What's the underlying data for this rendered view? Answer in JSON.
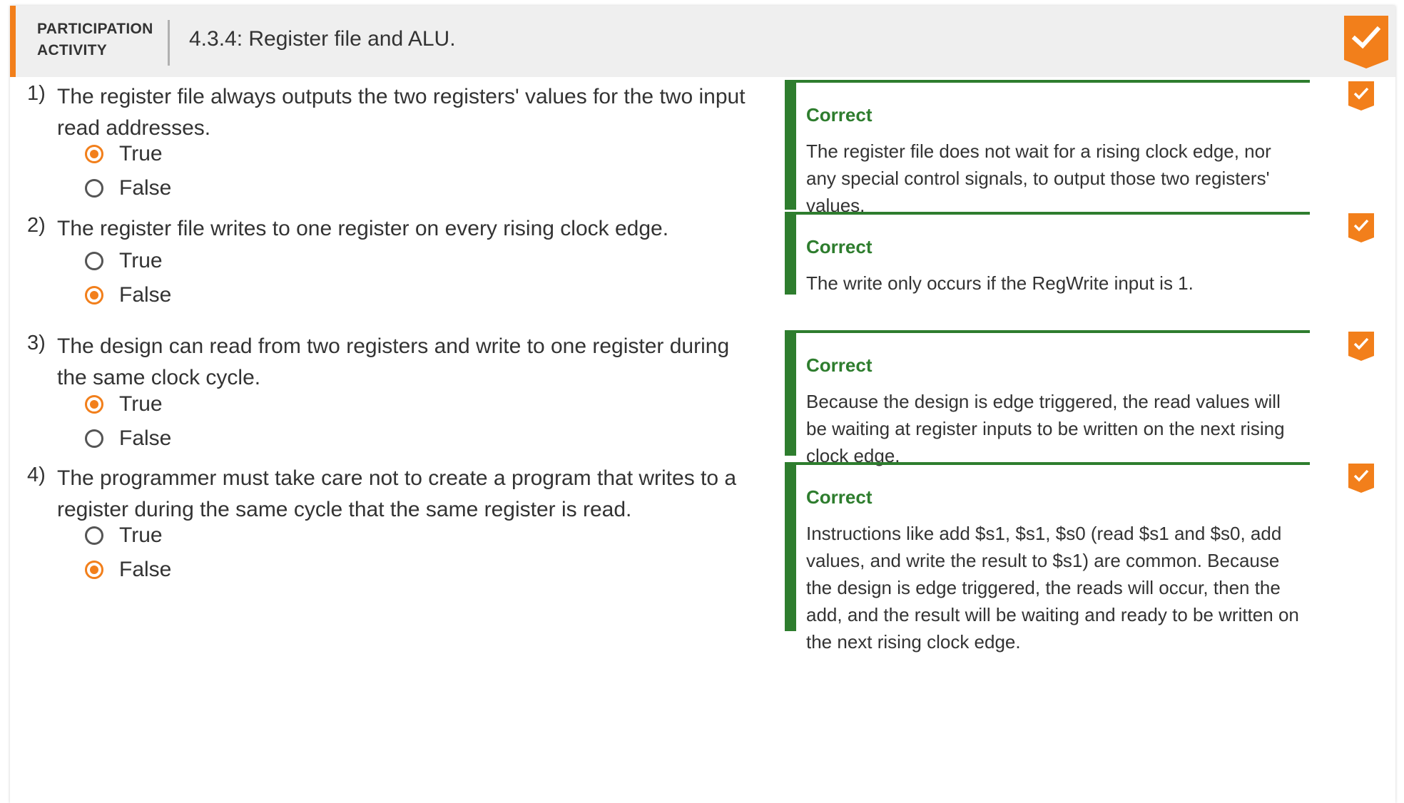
{
  "header": {
    "participation_label_line1": "PARTICIPATION",
    "participation_label_line2": "ACTIVITY",
    "activity_title": "4.3.4: Register file and ALU."
  },
  "colors": {
    "accent": "#f27f1b",
    "correct": "#2e7d2e"
  },
  "icons": {
    "completion": "checkmark-icon",
    "radio_selected": "radio-selected-icon",
    "radio_unselected": "radio-unselected-icon"
  },
  "questions": [
    {
      "number": "1)",
      "text": "The register file always outputs the two registers' values for the two input read addresses.",
      "options": [
        {
          "label": "True",
          "selected": true
        },
        {
          "label": "False",
          "selected": false
        }
      ],
      "feedback_title": "Correct",
      "feedback_text": "The register file does not wait for a rising clock edge, nor any special control signals, to output those two registers' values."
    },
    {
      "number": "2)",
      "text": "The register file writes to one register on every rising clock edge.",
      "options": [
        {
          "label": "True",
          "selected": false
        },
        {
          "label": "False",
          "selected": true
        }
      ],
      "feedback_title": "Correct",
      "feedback_text": "The write only occurs if the RegWrite input is 1."
    },
    {
      "number": "3)",
      "text": "The design can read from two registers and write to one register during the same clock cycle.",
      "options": [
        {
          "label": "True",
          "selected": true
        },
        {
          "label": "False",
          "selected": false
        }
      ],
      "feedback_title": "Correct",
      "feedback_text": "Because the design is edge triggered, the read values will be waiting at register inputs to be written on the next rising clock edge."
    },
    {
      "number": "4)",
      "text": "The programmer must take care not to create a program that writes to a register during the same cycle that the same register is read.",
      "options": [
        {
          "label": "True",
          "selected": false
        },
        {
          "label": "False",
          "selected": true
        }
      ],
      "feedback_title": "Correct",
      "feedback_text": "Instructions like add $s1, $s1, $s0 (read $s1 and $s0, add values, and write the result to $s1) are common. Because the design is edge triggered, the reads will occur, then the add, and the result will be waiting and ready to be written on the next rising clock edge."
    }
  ]
}
